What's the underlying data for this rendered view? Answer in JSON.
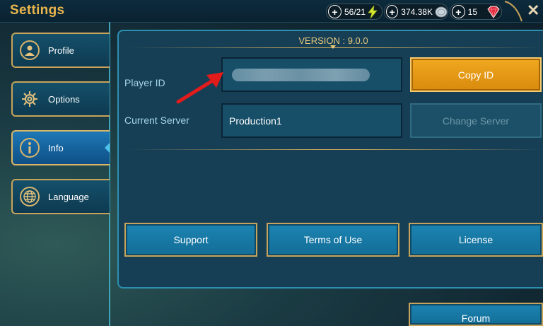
{
  "header": {
    "title": "Settings",
    "energy": "56/21",
    "silver": "374.38K",
    "gems": "15"
  },
  "sidebar": {
    "items": [
      {
        "label": "Profile",
        "icon": "profile-icon"
      },
      {
        "label": "Options",
        "icon": "gear-icon"
      },
      {
        "label": "Info",
        "icon": "info-icon",
        "active": true
      },
      {
        "label": "Language",
        "icon": "globe-icon"
      }
    ]
  },
  "info": {
    "version": "VERSION : 9.0.0",
    "player_id_label": "Player ID",
    "current_server_label": "Current Server",
    "current_server_value": "Production1",
    "copy_id_button": "Copy ID",
    "change_server_button": "Change Server",
    "support_button": "Support",
    "terms_button": "Terms of Use",
    "license_button": "License",
    "forum_button": "Forum"
  },
  "colors": {
    "title_gold": "#e8b54b",
    "copy_button": "#f0a820",
    "arrow_red": "#e21b1b",
    "panel_border": "#2c8fb0"
  }
}
